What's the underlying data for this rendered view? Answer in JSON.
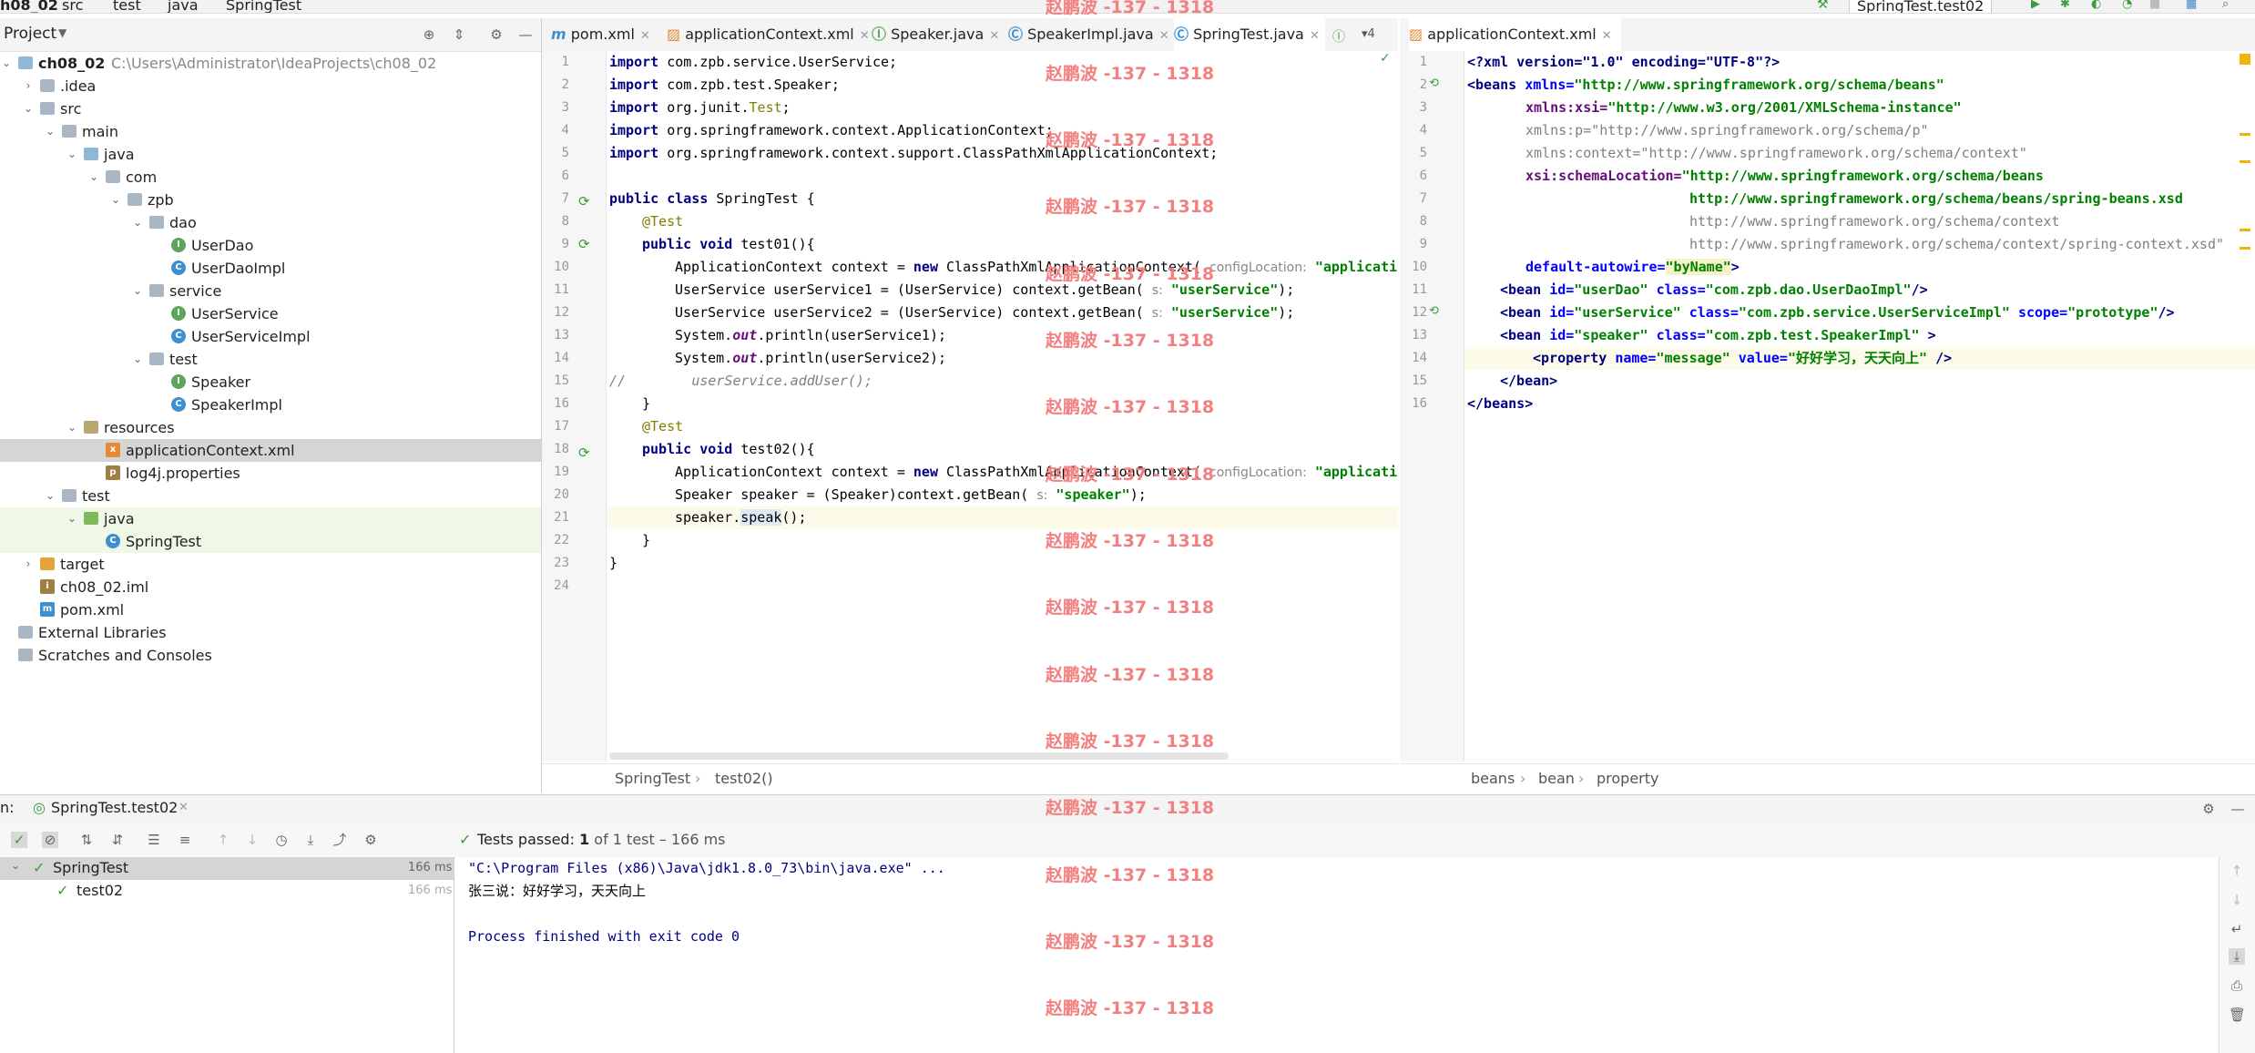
{
  "topbar": {
    "crumbs": [
      "h08_02",
      "src",
      "test",
      "java",
      "SpringTest"
    ],
    "run_config": "SpringTest.test02"
  },
  "project": {
    "title": "Project",
    "tree": [
      {
        "label": "ch08_02",
        "path": "C:\\Users\\Administrator\\IdeaProjects\\ch08_02",
        "icon": "module-folder-icon",
        "depth": 0
      },
      {
        "label": ".idea",
        "icon": "folder-icon",
        "depth": 1
      },
      {
        "label": "src",
        "icon": "folder-icon",
        "depth": 1
      },
      {
        "label": "main",
        "icon": "folder-icon",
        "depth": 2
      },
      {
        "label": "java",
        "icon": "source-folder-icon",
        "depth": 3
      },
      {
        "label": "com",
        "icon": "package-icon",
        "depth": 4
      },
      {
        "label": "zpb",
        "icon": "package-icon",
        "depth": 5
      },
      {
        "label": "dao",
        "icon": "package-icon",
        "depth": 6
      },
      {
        "label": "UserDao",
        "icon": "interface-icon",
        "depth": 7
      },
      {
        "label": "UserDaoImpl",
        "icon": "class-icon",
        "depth": 7
      },
      {
        "label": "service",
        "icon": "package-icon",
        "depth": 6
      },
      {
        "label": "UserService",
        "icon": "interface-icon",
        "depth": 7
      },
      {
        "label": "UserServiceImpl",
        "icon": "class-icon",
        "depth": 7
      },
      {
        "label": "test",
        "icon": "package-icon",
        "depth": 6
      },
      {
        "label": "Speaker",
        "icon": "interface-icon",
        "depth": 7
      },
      {
        "label": "SpeakerImpl",
        "icon": "class-icon",
        "depth": 7
      },
      {
        "label": "resources",
        "icon": "resources-folder-icon",
        "depth": 3
      },
      {
        "label": "applicationContext.xml",
        "icon": "xml-file-icon",
        "depth": 4
      },
      {
        "label": "log4j.properties",
        "icon": "properties-file-icon",
        "depth": 4
      },
      {
        "label": "test",
        "icon": "folder-icon",
        "depth": 2
      },
      {
        "label": "java",
        "icon": "test-folder-icon",
        "depth": 3
      },
      {
        "label": "SpringTest",
        "icon": "test-class-icon",
        "depth": 4
      },
      {
        "label": "target",
        "icon": "target-folder-icon",
        "depth": 1
      },
      {
        "label": "ch08_02.iml",
        "icon": "iml-file-icon",
        "depth": 1
      },
      {
        "label": "pom.xml",
        "icon": "maven-file-icon",
        "depth": 1
      },
      {
        "label": "External Libraries",
        "icon": "libraries-icon",
        "depth": 0
      },
      {
        "label": "Scratches and Consoles",
        "icon": "scratches-icon",
        "depth": 0
      }
    ]
  },
  "editor_left": {
    "tabs": [
      "pom.xml",
      "applicationContext.xml",
      "Speaker.java",
      "SpeakerImpl.java",
      "SpringTest.java"
    ],
    "tab_overflow": "4",
    "breadcrumb": [
      "SpringTest",
      "test02()"
    ]
  },
  "editor_right": {
    "tabs": [
      "applicationContext.xml"
    ],
    "breadcrumb": [
      "beans",
      "bean",
      "property"
    ]
  },
  "java_code": {
    "import1": "com.zpb.service.UserService;",
    "import2": "com.zpb.test.Speaker;",
    "import3_a": "org.junit.",
    "import3_b": "Test",
    "import4": "org.springframework.context.ApplicationContext;",
    "import5": "org.springframework.context.support.ClassPathXmlApplicationContext;",
    "class_name": "SpringTest {",
    "ann": "@Test",
    "m1": "test01(){",
    "ctx_new": "ApplicationContext context = ",
    "ctx_new2": "ClassPathXmlApplicationContext(",
    "hint_config": "configLocation:",
    "str_appctx": "\"applicati",
    "us1": "UserService userService1 = (UserService) context.getBean(",
    "us2": "UserService userService2 = (UserService) context.getBean(",
    "hint_s": "s:",
    "str_us": "\"userService\"",
    "end_call": ");",
    "sysout1_a": "System.",
    "sysout_out": "out",
    "sysout1_b": ".println(userService1);",
    "sysout2_b": ".println(userService2);",
    "comment_slash": "//",
    "comment_body": "userService.addUser();",
    "close_brace": "}",
    "m2": "test02(){",
    "sp_line": "Speaker speaker = (Speaker)context.getBean(",
    "str_speaker": "\"speaker\"",
    "speak_a": "speaker.",
    "speak_b": "speak",
    "speak_c": "();",
    "kw_import": "import",
    "kw_public": "public",
    "kw_class": "class",
    "kw_void": "void",
    "kw_new": "new"
  },
  "xml_code": {
    "l1": "<?xml version=\"1.0\" encoding=\"UTF-8\"?>",
    "l2_tag": "<beans",
    "l2_attr": "xmlns=",
    "l2_val": "\"http://www.springframework.org/schema/beans\"",
    "l3_attr": "xmlns:xsi=",
    "l3_val": "\"http://www.w3.org/2001/XMLSchema-instance\"",
    "l4": "xmlns:p=\"http://www.springframework.org/schema/p\"",
    "l5": "xmlns:context=\"http://www.springframework.org/schema/context\"",
    "l6_attr": "xsi:schemaLocation=",
    "l6_val": "\"http://www.springframework.org/schema/beans",
    "l7": "http://www.springframework.org/schema/beans/spring-beans.xsd",
    "l8": "http://www.springframework.org/schema/context",
    "l9": "http://www.springframework.org/schema/context/spring-context.xsd\"",
    "l10_attr": "default-autowire=",
    "l10_val": "\"byName\"",
    "l10_end": ">",
    "l11_tag": "<bean",
    "l11_a1": "id=",
    "l11_v1": "\"userDao\"",
    "l11_a2": "class=",
    "l11_v2": "\"com.zpb.dao.UserDaoImpl\"",
    "l11_end": "/>",
    "l12_v1": "\"userService\"",
    "l12_v2": "\"com.zpb.service.UserServiceImpl\"",
    "l12_a3": "scope=",
    "l12_v3": "\"prototype\"",
    "l13_v1": "\"speaker\"",
    "l13_v2": "\"com.zpb.test.SpeakerImpl\"",
    "l13_end": ">",
    "l14_tag": "<property",
    "l14_a1": "name=",
    "l14_v1": "\"message\"",
    "l14_a2": "value=",
    "l14_v2": "\"好好学习，天天向上\"",
    "l14_end": "/>",
    "l15": "</bean>",
    "l16": "</beans>"
  },
  "run": {
    "label": "n:",
    "tab": "SpringTest.test02",
    "status": "Tests passed:",
    "status_count": "1",
    "status_rest": "of 1 test – 166 ms",
    "tree": [
      {
        "label": "SpringTest",
        "time": "166 ms"
      },
      {
        "label": "test02",
        "time": "166 ms"
      }
    ],
    "console": [
      "\"C:\\Program Files (x86)\\Java\\jdk1.8.0_73\\bin\\java.exe\" ...",
      "张三说：好好学习，天天向上",
      "",
      "Process finished with exit code 0"
    ]
  },
  "watermark": "赵鹏波 -137 - 1318",
  "colors": {
    "accent": "#4083c9",
    "pass_green": "#3c9b3c",
    "watermark": "#f28080",
    "string_green": "#008000",
    "keyword_navy": "#000080"
  }
}
